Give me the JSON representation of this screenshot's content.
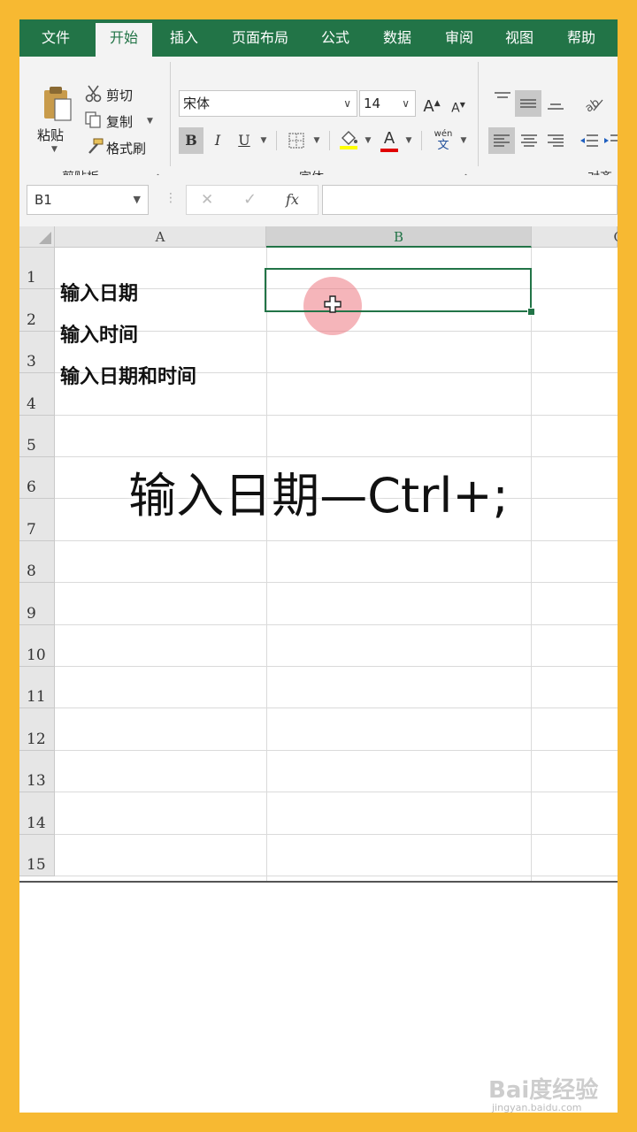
{
  "tabs": [
    {
      "label": "文件",
      "active": false
    },
    {
      "label": "开始",
      "active": true
    },
    {
      "label": "插入",
      "active": false
    },
    {
      "label": "页面布局",
      "active": false
    },
    {
      "label": "公式",
      "active": false
    },
    {
      "label": "数据",
      "active": false
    },
    {
      "label": "审阅",
      "active": false
    },
    {
      "label": "视图",
      "active": false
    },
    {
      "label": "帮助",
      "active": false
    }
  ],
  "clipboard": {
    "paste_label": "粘贴",
    "cut_label": "剪切",
    "copy_label": "复制",
    "format_painter_label": "格式刷",
    "group_label": "剪贴板"
  },
  "font": {
    "name": "宋体",
    "size": "14",
    "group_label": "字体",
    "bold": "B",
    "italic": "I",
    "underline": "U",
    "font_color_glyph": "A",
    "phonetic_top": "wén",
    "phonetic_bottom": "文",
    "grow_glyph": "A",
    "shrink_glyph": "A"
  },
  "alignment": {
    "group_label": "对齐"
  },
  "formula_bar": {
    "name_box": "B1",
    "cancel": "✕",
    "enter": "✓",
    "fx": "fx",
    "value": ""
  },
  "columns": [
    "A",
    "B",
    "C"
  ],
  "rows": [
    "1",
    "2",
    "3",
    "4",
    "5",
    "6",
    "7",
    "8",
    "9",
    "10",
    "11",
    "12",
    "13",
    "14",
    "15"
  ],
  "cells": {
    "A1": "输入日期",
    "A2": "输入时间",
    "A3": "输入日期和时间"
  },
  "selected_column": "B",
  "caption": "输入日期—Ctrl+;",
  "colors": {
    "accent": "#227447",
    "frame": "#f7b932"
  },
  "watermark": {
    "main": "Bai度经验",
    "url": "jingyan.baidu.com"
  }
}
